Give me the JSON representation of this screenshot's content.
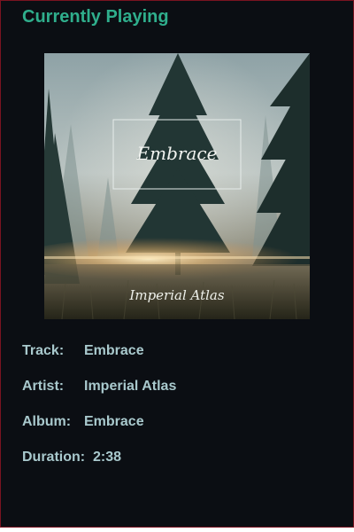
{
  "header": {
    "title": "Currently Playing"
  },
  "album_art": {
    "cover_title": "Embrace",
    "cover_artist": "Imperial Atlas",
    "colors": {
      "sky_top": "#8fa4a8",
      "fog": "#c7cdca",
      "trees": "#1f3230",
      "glow": "#f3c98c",
      "grass": "#3a3a2c"
    }
  },
  "track_info": {
    "track_label": "Track:",
    "track_value": "Embrace",
    "artist_label": "Artist:",
    "artist_value": "Imperial Atlas",
    "album_label": "Album:",
    "album_value": "Embrace",
    "duration_label": "Duration:",
    "duration_value": "2:38"
  },
  "colors": {
    "background": "#0b0e13",
    "accent": "#2fae8c",
    "text": "#a9c9cd",
    "border": "#7a1420"
  }
}
